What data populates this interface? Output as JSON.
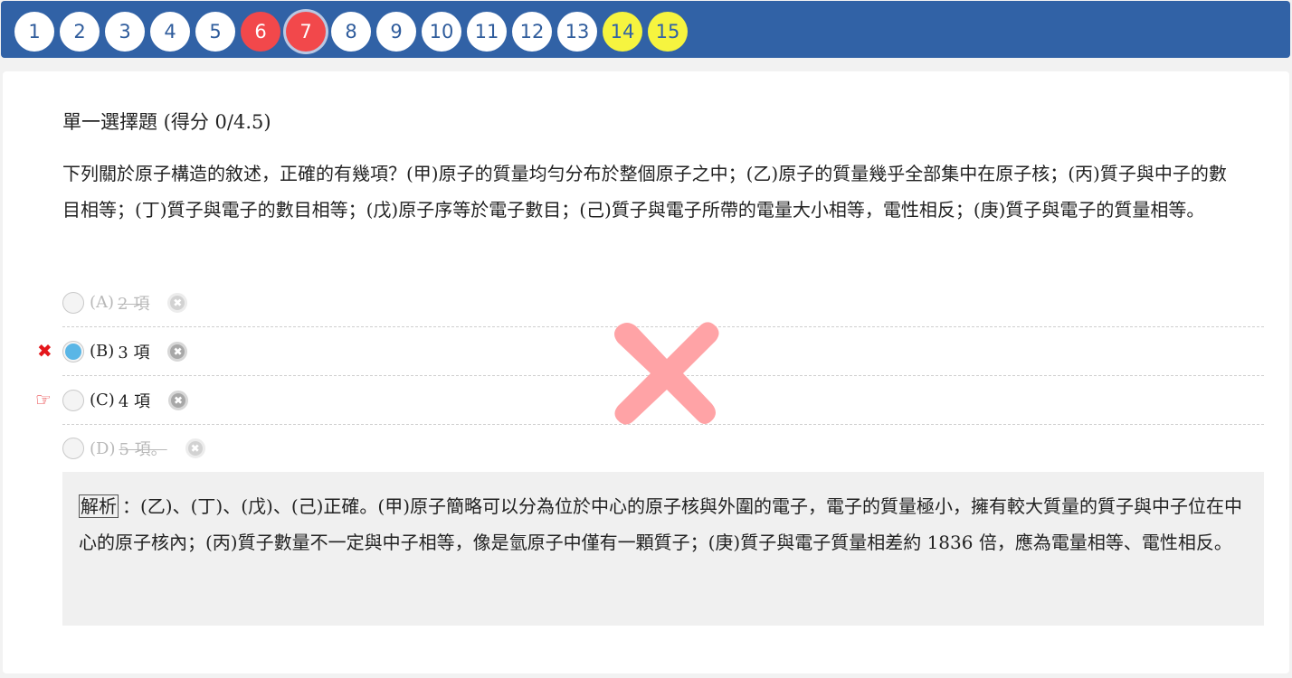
{
  "nav": {
    "questions": [
      {
        "num": "1",
        "state": "normal"
      },
      {
        "num": "2",
        "state": "normal"
      },
      {
        "num": "3",
        "state": "normal"
      },
      {
        "num": "4",
        "state": "normal"
      },
      {
        "num": "5",
        "state": "normal"
      },
      {
        "num": "6",
        "state": "wrong"
      },
      {
        "num": "7",
        "state": "current"
      },
      {
        "num": "8",
        "state": "normal"
      },
      {
        "num": "9",
        "state": "normal"
      },
      {
        "num": "10",
        "state": "normal"
      },
      {
        "num": "11",
        "state": "normal"
      },
      {
        "num": "12",
        "state": "normal"
      },
      {
        "num": "13",
        "state": "normal"
      },
      {
        "num": "14",
        "state": "flagged"
      },
      {
        "num": "15",
        "state": "flagged"
      }
    ]
  },
  "question": {
    "title": "單一選擇題 (得分 0/4.5)",
    "text": "下列關於原子構造的敘述，正確的有幾項？(甲)原子的質量均勻分布於整個原子之中；(乙)原子的質量幾乎全部集中在原子核；(丙)質子與中子的數目相等；(丁)質子與電子的數目相等；(戊)原子序等於電子數目；(己)質子與電子所帶的電量大小相等，電性相反；(庚)質子與電子的質量相等。",
    "options": [
      {
        "letter": "(A)",
        "text": "2 項",
        "eliminated": true,
        "selected": false
      },
      {
        "letter": "(B)",
        "text": "3 項",
        "eliminated": false,
        "selected": true
      },
      {
        "letter": "(C)",
        "text": "4 項",
        "eliminated": false,
        "selected": false
      },
      {
        "letter": "(D)",
        "text": "5 項。",
        "eliminated": true,
        "selected": false
      }
    ],
    "wrong_mark": "✖",
    "answer_mark": "☞",
    "eliminate_glyph": "✖"
  },
  "explanation": {
    "label": "解析",
    "text": "：(乙)、(丁)、(戊)、(己)正確。(甲)原子簡略可以分為位於中心的原子核與外圍的電子，電子的質量極小，擁有較大質量的質子與中子位在中心的原子核內；(丙)質子數量不一定與中子相等，像是氫原子中僅有一顆質子；(庚)質子與電子質量相差約 1836 倍，應為電量相等、電性相反。"
  },
  "colors": {
    "nav_bg": "#3162a6",
    "wrong": "#f2484b",
    "flagged": "#f6f43f",
    "big_x": "#ffa3a6",
    "selected_radio": "#5ab6e6"
  }
}
